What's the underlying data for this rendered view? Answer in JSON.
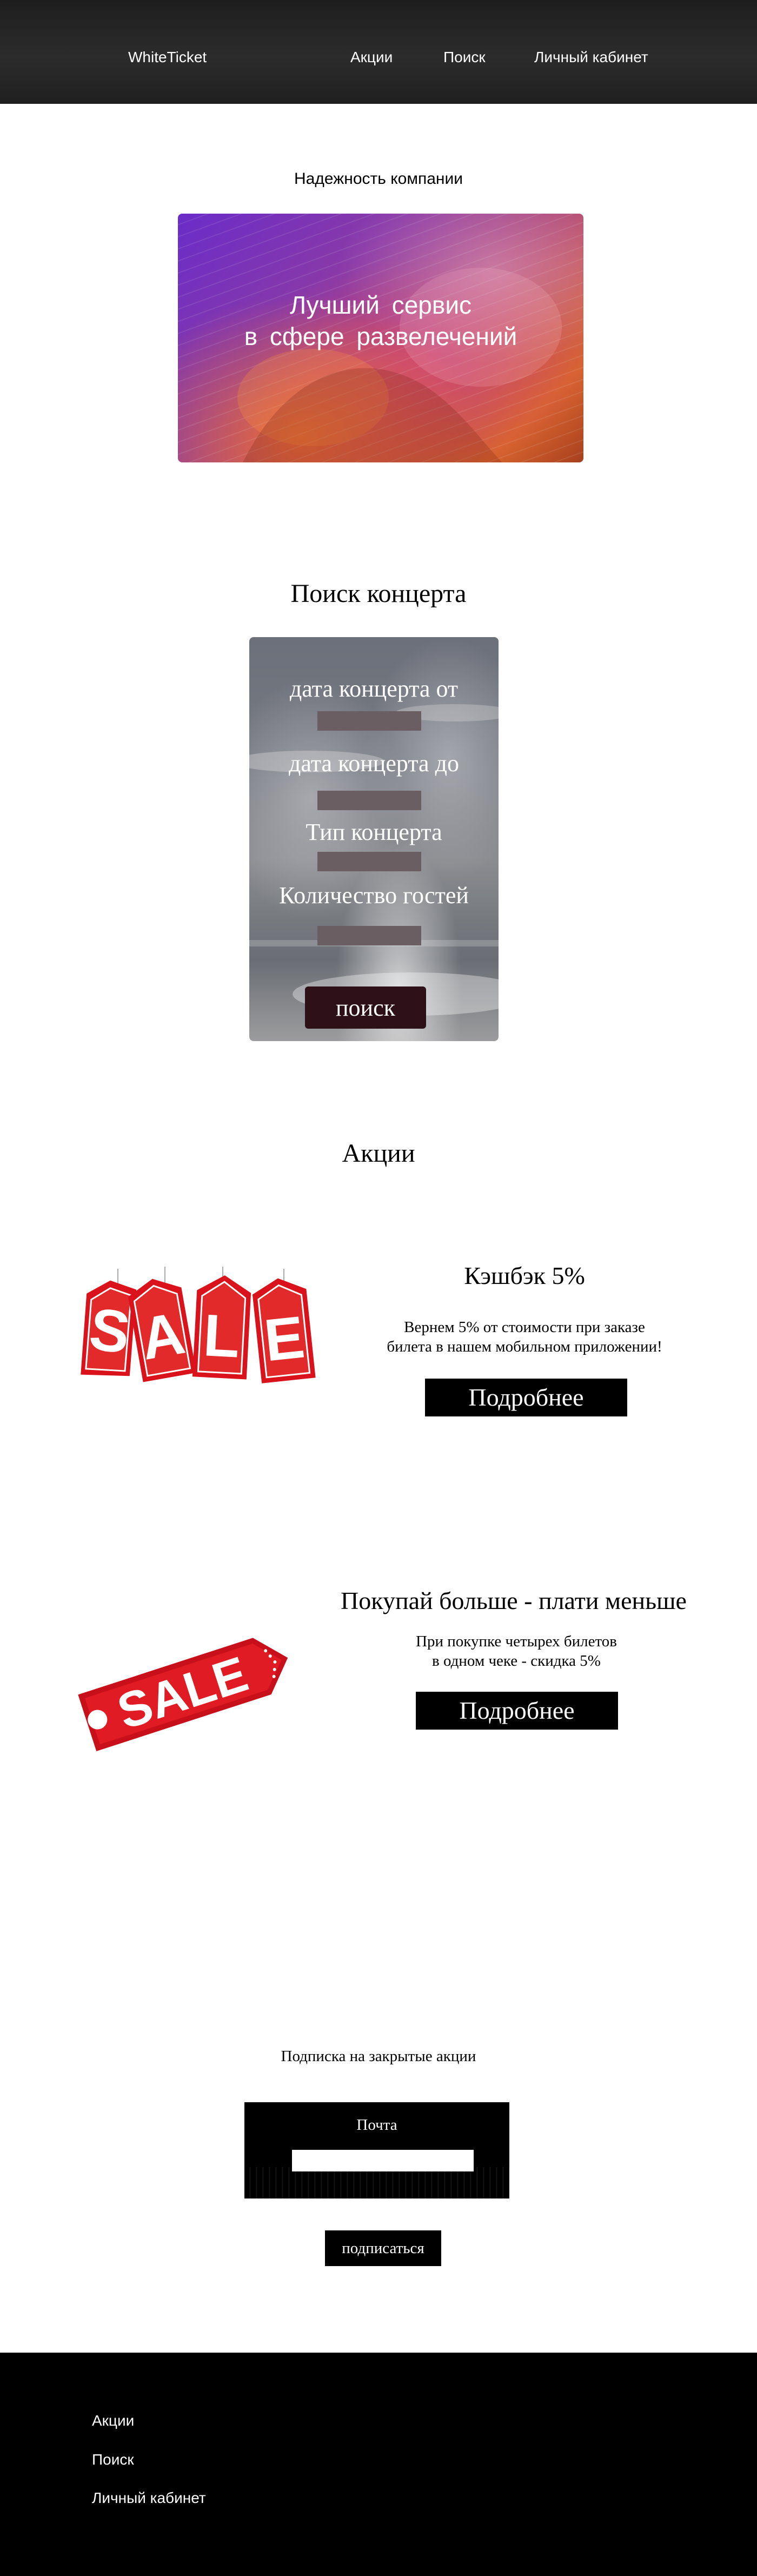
{
  "header": {
    "logo": "WhiteTicket",
    "nav": [
      "Акции",
      "Поиск",
      "Личный кабинет"
    ]
  },
  "hero": {
    "subtitle": "Надежность компании",
    "line1": "Лучший  сервис",
    "line2": "в  сфере  развелечений"
  },
  "search": {
    "title": "Поиск концерта",
    "fields": [
      "дата концерта от",
      "дата концерта до",
      "Тип концерта",
      "Количество гостей"
    ],
    "button": "поиск"
  },
  "promotions": {
    "title": "Акции",
    "items": [
      {
        "badge": "SALE",
        "heading": "Кэшбэк 5%",
        "desc1": "Вернем 5% от стоимости при заказе",
        "desc2": "билета в нашем мобильном приложении!",
        "button": "Подробнее"
      },
      {
        "badge": "SALE",
        "heading": "Покупай больше - плати меньше",
        "desc1": "При покупке четырех билетов",
        "desc2": "в одном чеке - скидка 5%",
        "button": "Подробнее"
      }
    ]
  },
  "subscribe": {
    "title": "Подписка на закрытые акции",
    "email_label": "Почта",
    "button": "подписаться"
  },
  "footer": {
    "links": [
      "Акции",
      "Поиск",
      "Личный кабинет"
    ]
  },
  "colors": {
    "header_bg": "#232323",
    "sale_red": "#d9121c",
    "field_bg": "#6b5e63",
    "search_button_bg": "#2e1019",
    "footer_bg": "#000000"
  }
}
